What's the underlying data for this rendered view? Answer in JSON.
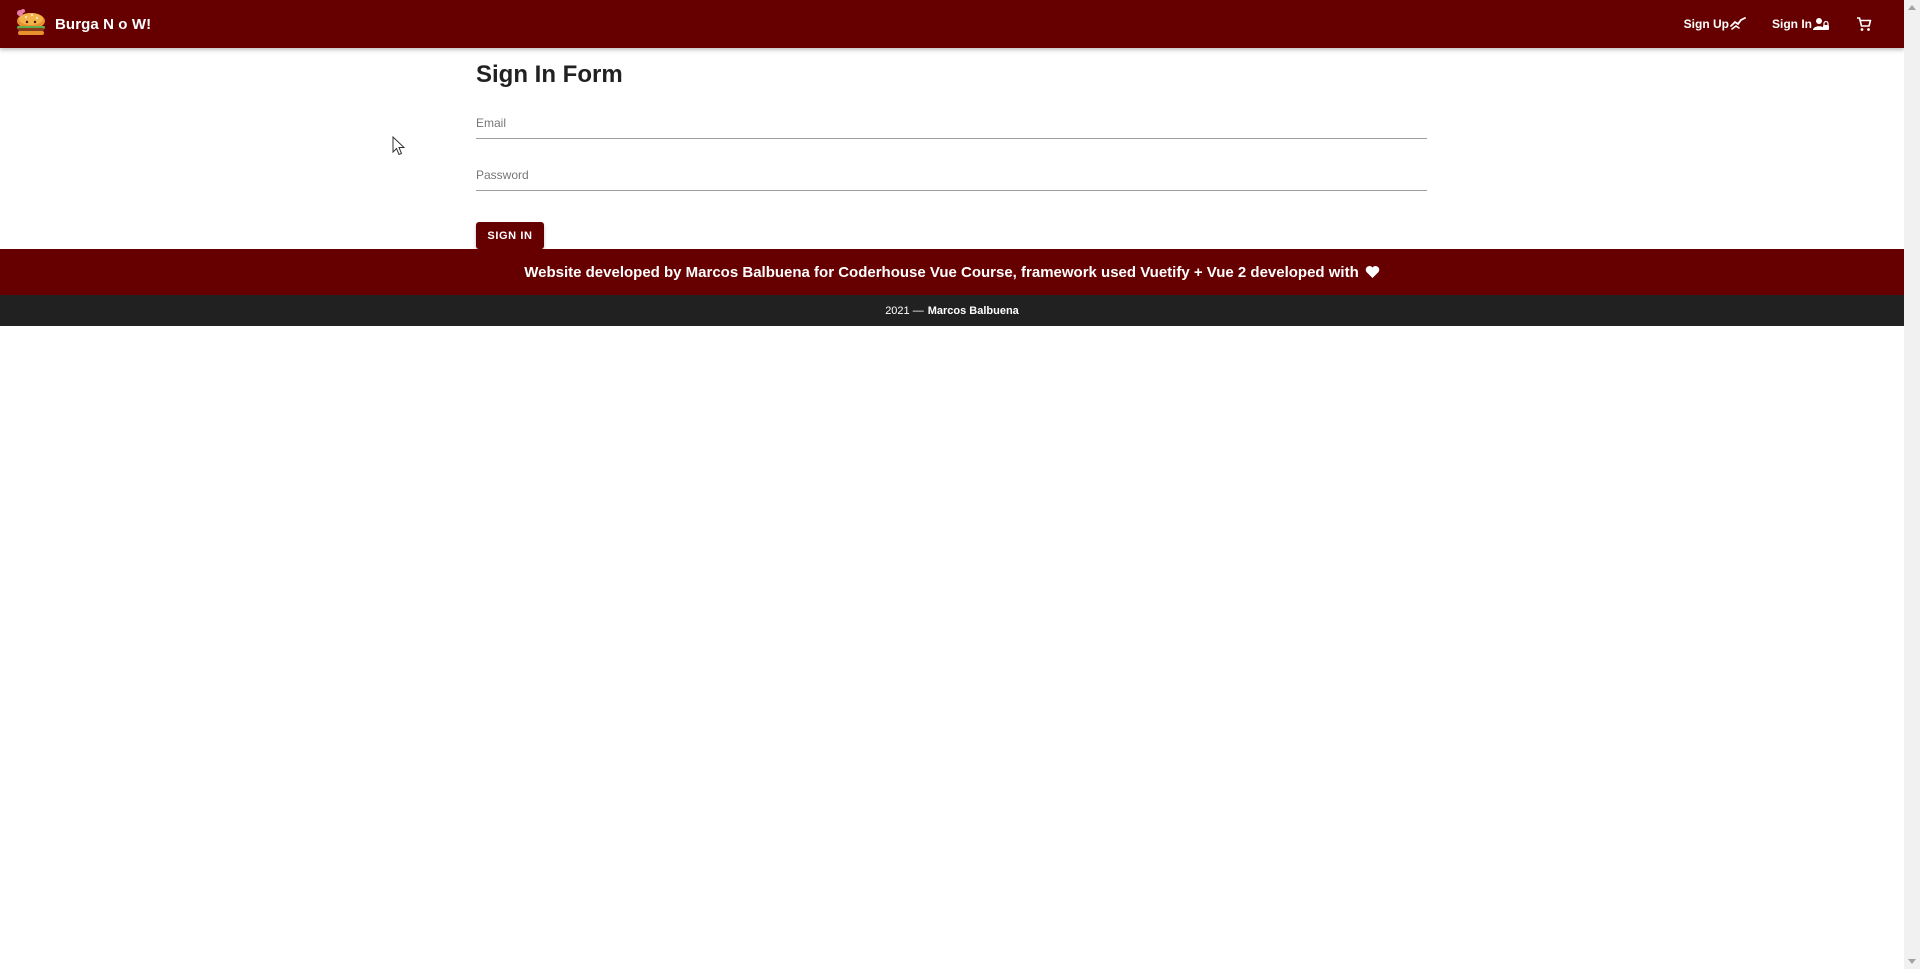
{
  "header": {
    "brand_title": "Burga N o W!",
    "brand_logo": "burger-logo",
    "nav": [
      {
        "label": "Sign Up",
        "icon": "handshake-icon"
      },
      {
        "label": "Sign In",
        "icon": "account-lock-icon"
      },
      {
        "label": "",
        "icon": "cart-icon"
      }
    ]
  },
  "form": {
    "title": "Sign In Form",
    "email_label": "Email",
    "email_value": "",
    "password_label": "Password",
    "password_value": "",
    "submit_label": "SIGN IN"
  },
  "footer": {
    "credit_text": "Website developed by Marcos Balbuena for Coderhouse Vue Course, framework used Vuetify + Vue 2 developed with",
    "heart_icon": "heart-icon",
    "copyright_year": "2021 —",
    "copyright_name": "Marcos Balbuena"
  },
  "colors": {
    "primary": "#660000",
    "footer_dark": "#212121",
    "text": "#212121"
  }
}
